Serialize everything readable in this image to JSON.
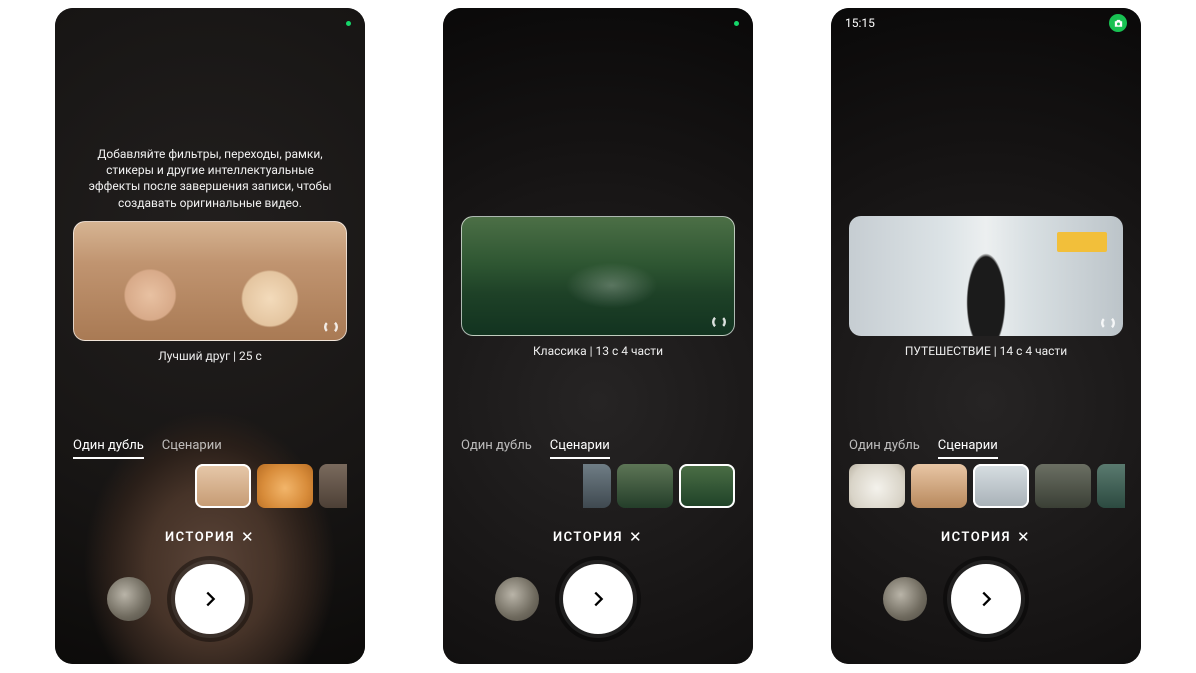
{
  "common": {
    "tab_single": "Один дубль",
    "tab_scenarios": "Сценарии",
    "story_label": "ИСТОРИЯ",
    "story_close": "✕"
  },
  "phone1": {
    "tip": "Добавляйте фильтры, переходы, рамки, стикеры и другие интеллектуальные эффекты после завершения записи, чтобы создавать оригинальные видео.",
    "preview_caption": "Лучший друг | 25 с",
    "active_tab": "single",
    "thumbs": [
      {
        "cls": "th-friends",
        "selected": true
      },
      {
        "cls": "th-dog",
        "selected": false
      },
      {
        "cls": "th-coffee",
        "selected": false,
        "partial": "r"
      }
    ]
  },
  "phone2": {
    "preview_caption": "Классика | 13 с 4 части",
    "active_tab": "scenarios",
    "thumbs": [
      {
        "cls": "th-city",
        "selected": false,
        "partial": "l"
      },
      {
        "cls": "th-bridge",
        "selected": false
      },
      {
        "cls": "th-garden",
        "selected": true
      }
    ]
  },
  "phone3": {
    "status_time": "15:15",
    "preview_caption": "ПУТЕШЕСТВИЕ | 14 с 4 части",
    "active_tab": "scenarios",
    "thumbs": [
      {
        "cls": "th-cat",
        "selected": false
      },
      {
        "cls": "th-trio",
        "selected": false
      },
      {
        "cls": "th-street",
        "selected": true
      },
      {
        "cls": "th-rock",
        "selected": false
      },
      {
        "cls": "th-water",
        "selected": false,
        "partial": "r"
      }
    ]
  }
}
